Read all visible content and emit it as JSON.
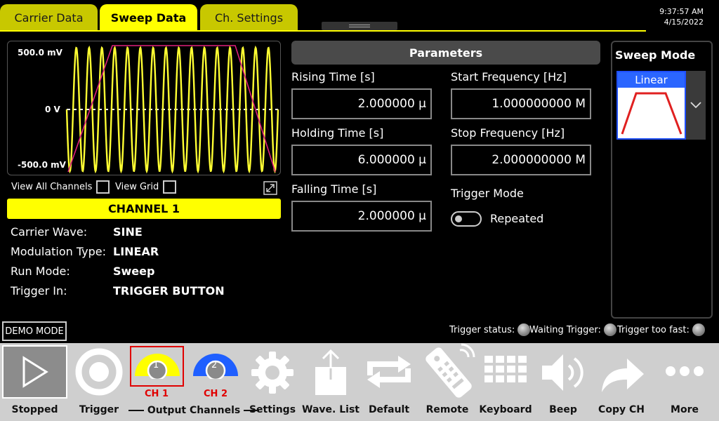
{
  "tabs": [
    "Carrier Data",
    "Sweep Data",
    "Ch. Settings"
  ],
  "active_tab": "Sweep Data",
  "clock": {
    "time": "9:37:57 AM",
    "date": "4/15/2022"
  },
  "scope": {
    "ymax": "500.0 mV",
    "ymid": "0 V",
    "ymin": "-500.0 mV"
  },
  "options": {
    "view_all_channels": "View All Channels",
    "view_grid": "View Grid"
  },
  "channel_banner": "CHANNEL 1",
  "info": [
    {
      "key": "Carrier Wave:",
      "value": "SINE"
    },
    {
      "key": "Modulation Type:",
      "value": "LINEAR"
    },
    {
      "key": "Run Mode:",
      "value": "Sweep"
    },
    {
      "key": "Trigger In:",
      "value": "TRIGGER BUTTON"
    }
  ],
  "parameters": {
    "header": "Parameters",
    "rising_time": {
      "label": "Rising Time [s]",
      "value": "2.000000 µ"
    },
    "holding_time": {
      "label": "Holding Time [s]",
      "value": "6.000000 µ"
    },
    "falling_time": {
      "label": "Falling Time [s]",
      "value": "2.000000 µ"
    },
    "start_freq": {
      "label": "Start Frequency [Hz]",
      "value": "1.000000000 M"
    },
    "stop_freq": {
      "label": "Stop Frequency [Hz]",
      "value": "2.000000000 M"
    },
    "trigger_mode": {
      "label": "Trigger Mode",
      "value": "Repeated"
    }
  },
  "sweep_mode": {
    "title": "Sweep Mode",
    "selected": "Linear"
  },
  "demo_mode": "DEMO MODE",
  "trigger_status": [
    {
      "label": "Trigger status:"
    },
    {
      "label": "Waiting Trigger:"
    },
    {
      "label": "Trigger too fast:"
    }
  ],
  "toolbar": {
    "stopped": "Stopped",
    "trigger": "Trigger",
    "ch1": "CH 1",
    "ch1_num": "1",
    "ch2": "CH 2",
    "ch2_num": "2",
    "output_channels": "Output Channels",
    "settings": "Settings",
    "wave_list": "Wave. List",
    "default": "Default",
    "remote": "Remote",
    "keyboard": "Keyboard",
    "beep": "Beep",
    "copy_ch": "Copy CH",
    "more": "More"
  },
  "colors": {
    "accent": "#ffff00",
    "tab_inactive": "#c8c800",
    "ch1": "#ffff00",
    "ch2": "#1f5fff",
    "sweep_envelope": "#e0207a",
    "selection": "#e00000"
  }
}
